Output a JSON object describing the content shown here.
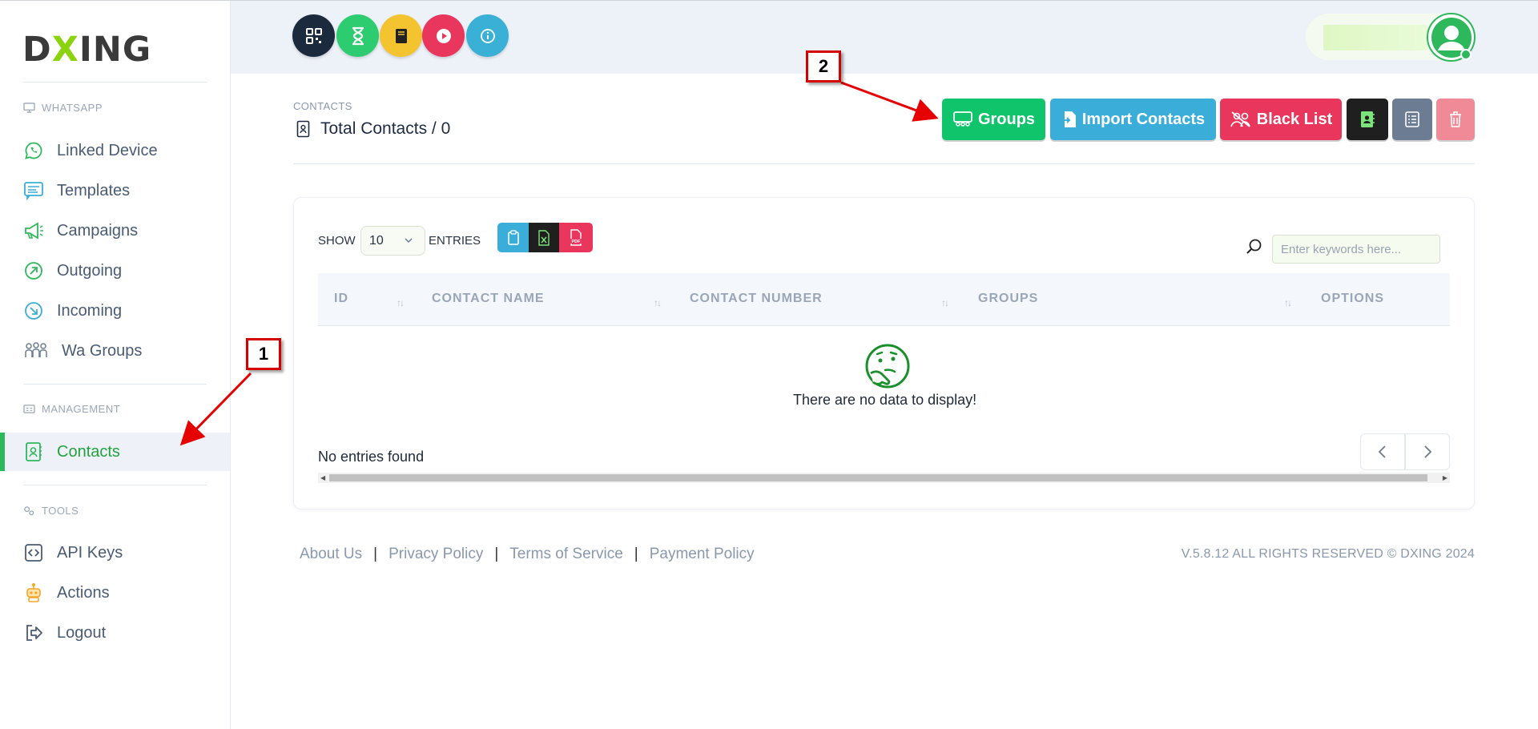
{
  "brand": {
    "logo_part1": "D",
    "logo_x": "X",
    "logo_part2": "ING"
  },
  "sidebar": {
    "sections": [
      {
        "label": "WHATSAPP"
      },
      {
        "label": "MANAGEMENT"
      },
      {
        "label": "TOOLS"
      }
    ],
    "items": [
      {
        "label": "Linked Device",
        "icon": "whatsapp-icon"
      },
      {
        "label": "Templates",
        "icon": "template-icon"
      },
      {
        "label": "Campaigns",
        "icon": "megaphone-icon"
      },
      {
        "label": "Outgoing",
        "icon": "outgoing-arrow-icon"
      },
      {
        "label": "Incoming",
        "icon": "incoming-arrow-icon"
      },
      {
        "label": "Wa Groups",
        "icon": "people-group-icon"
      },
      {
        "label": "Contacts",
        "icon": "contact-book-icon",
        "active": true
      },
      {
        "label": "API Keys",
        "icon": "code-icon"
      },
      {
        "label": "Actions",
        "icon": "robot-icon"
      },
      {
        "label": "Logout",
        "icon": "logout-icon"
      }
    ]
  },
  "topbar": {
    "shortcuts": [
      {
        "icon": "qr-code-icon",
        "color": "#1b2a3d"
      },
      {
        "icon": "hourglass-icon",
        "color": "#2ecc71"
      },
      {
        "icon": "book-icon",
        "color": "#f4c430"
      },
      {
        "icon": "play-icon",
        "color": "#e8365d"
      },
      {
        "icon": "info-icon",
        "color": "#3ab0d6"
      }
    ]
  },
  "header": {
    "breadcrumb": "CONTACTS",
    "title": "Total Contacts / 0"
  },
  "actions": {
    "groups": "Groups",
    "import": "Import Contacts",
    "blacklist": "Black List",
    "colors": {
      "groups": "#10c46b",
      "import": "#3aaed8",
      "blacklist": "#e8365d",
      "contact": "#1f1f1f",
      "list": "#6b7c93",
      "delete": "#f08a96"
    }
  },
  "table": {
    "show_label": "SHOW",
    "page_size": "10",
    "entries_label": "ENTRIES",
    "search_placeholder": "Enter keywords here...",
    "columns": [
      "ID",
      "CONTACT NAME",
      "CONTACT NUMBER",
      "GROUPS",
      "OPTIONS"
    ],
    "empty_message": "There are no data to display!",
    "footer_info": "No entries found"
  },
  "footer": {
    "links": [
      "About Us",
      "Privacy Policy",
      "Terms of Service",
      "Payment Policy"
    ],
    "separator": "|",
    "copyright": "V.5.8.12 ALL RIGHTS RESERVED © DXING 2024"
  },
  "annotations": [
    "1",
    "2"
  ]
}
